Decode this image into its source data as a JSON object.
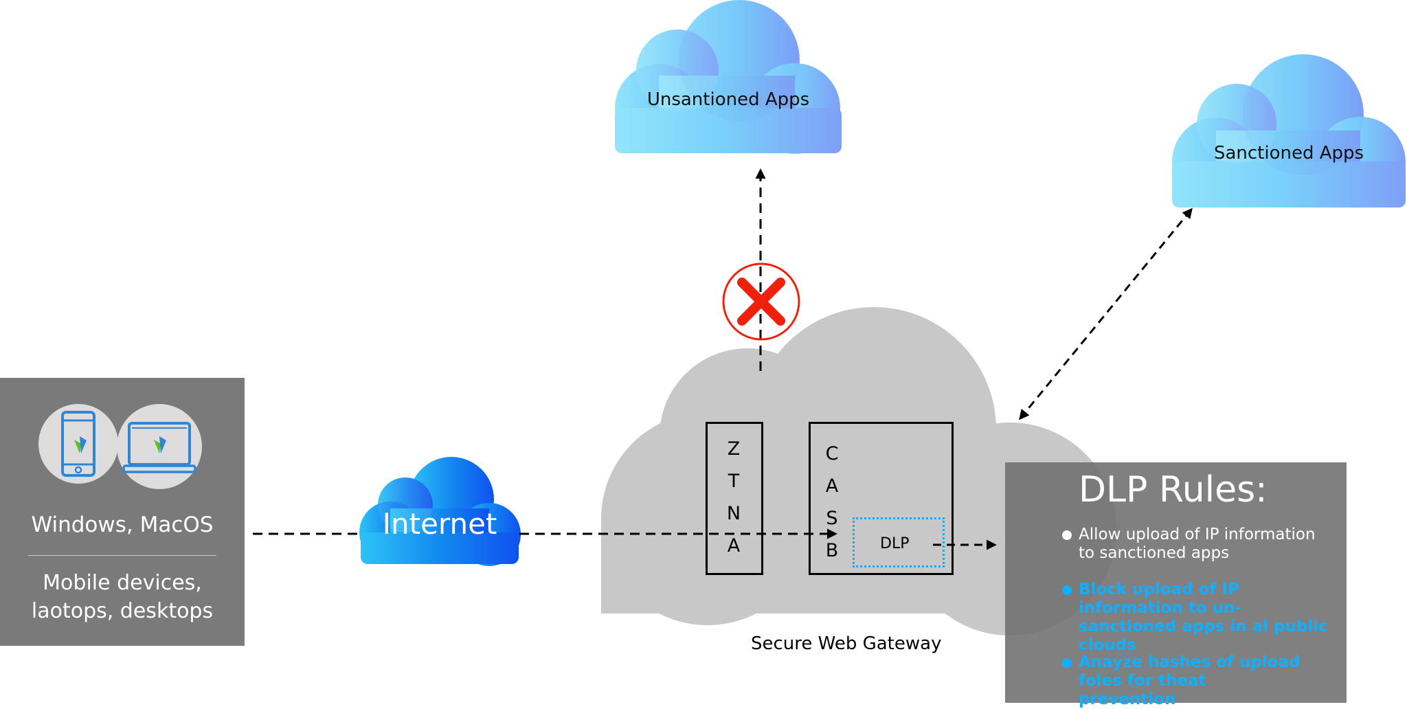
{
  "diagram": {
    "devices": {
      "icons": [
        "smartphone-icon",
        "laptop-icon"
      ],
      "platforms_label": "Windows, MacOS",
      "device_types_label": "Mobile devices, laotops, desktops"
    },
    "internet_cloud": {
      "label": "Internet"
    },
    "unsanctioned_cloud": {
      "label": "Unsantioned Apps",
      "status": "blocked"
    },
    "sanctioned_cloud": {
      "label": "Sanctioned Apps",
      "status": "allowed"
    },
    "gateway": {
      "label": "Secure Web Gateway",
      "ztna": {
        "letters": [
          "Z",
          "T",
          "N",
          "A"
        ]
      },
      "casb": {
        "letters": [
          "C",
          "A",
          "S",
          "B"
        ]
      },
      "dlp_module": {
        "label": "DLP"
      }
    },
    "dlp_rules": {
      "title": "DLP Rules:",
      "rules": [
        {
          "text": "Allow upload of IP information to sanctioned apps",
          "color": "#ffffff"
        },
        {
          "text": "Block upload of IP information to un-sanctioned apps in al public clouds",
          "color": "#0fb0ff"
        },
        {
          "text": "Anayze hashes of upload foles for theat prevention",
          "color": "#0fb0ff"
        }
      ]
    },
    "connections": [
      {
        "from": "devices",
        "to": "internet",
        "type": "dashed"
      },
      {
        "from": "internet",
        "to": "casb",
        "type": "dashed-arrow"
      },
      {
        "from": "gateway",
        "to": "unsanctioned_apps",
        "type": "dashed-arrow",
        "blocked": true
      },
      {
        "from": "gateway",
        "to": "sanctioned_apps",
        "type": "dashed-bidirectional"
      },
      {
        "from": "dlp",
        "to": "dlp_rules",
        "type": "dashed-arrow"
      }
    ],
    "colors": {
      "block_mark": "#f0210c",
      "gateway_cloud": "#c8c8c8",
      "dlp_dotted_border": "#21a7f0",
      "panel_gray": "#7a7a7a",
      "highlight_blue": "#0fb0ff"
    }
  }
}
